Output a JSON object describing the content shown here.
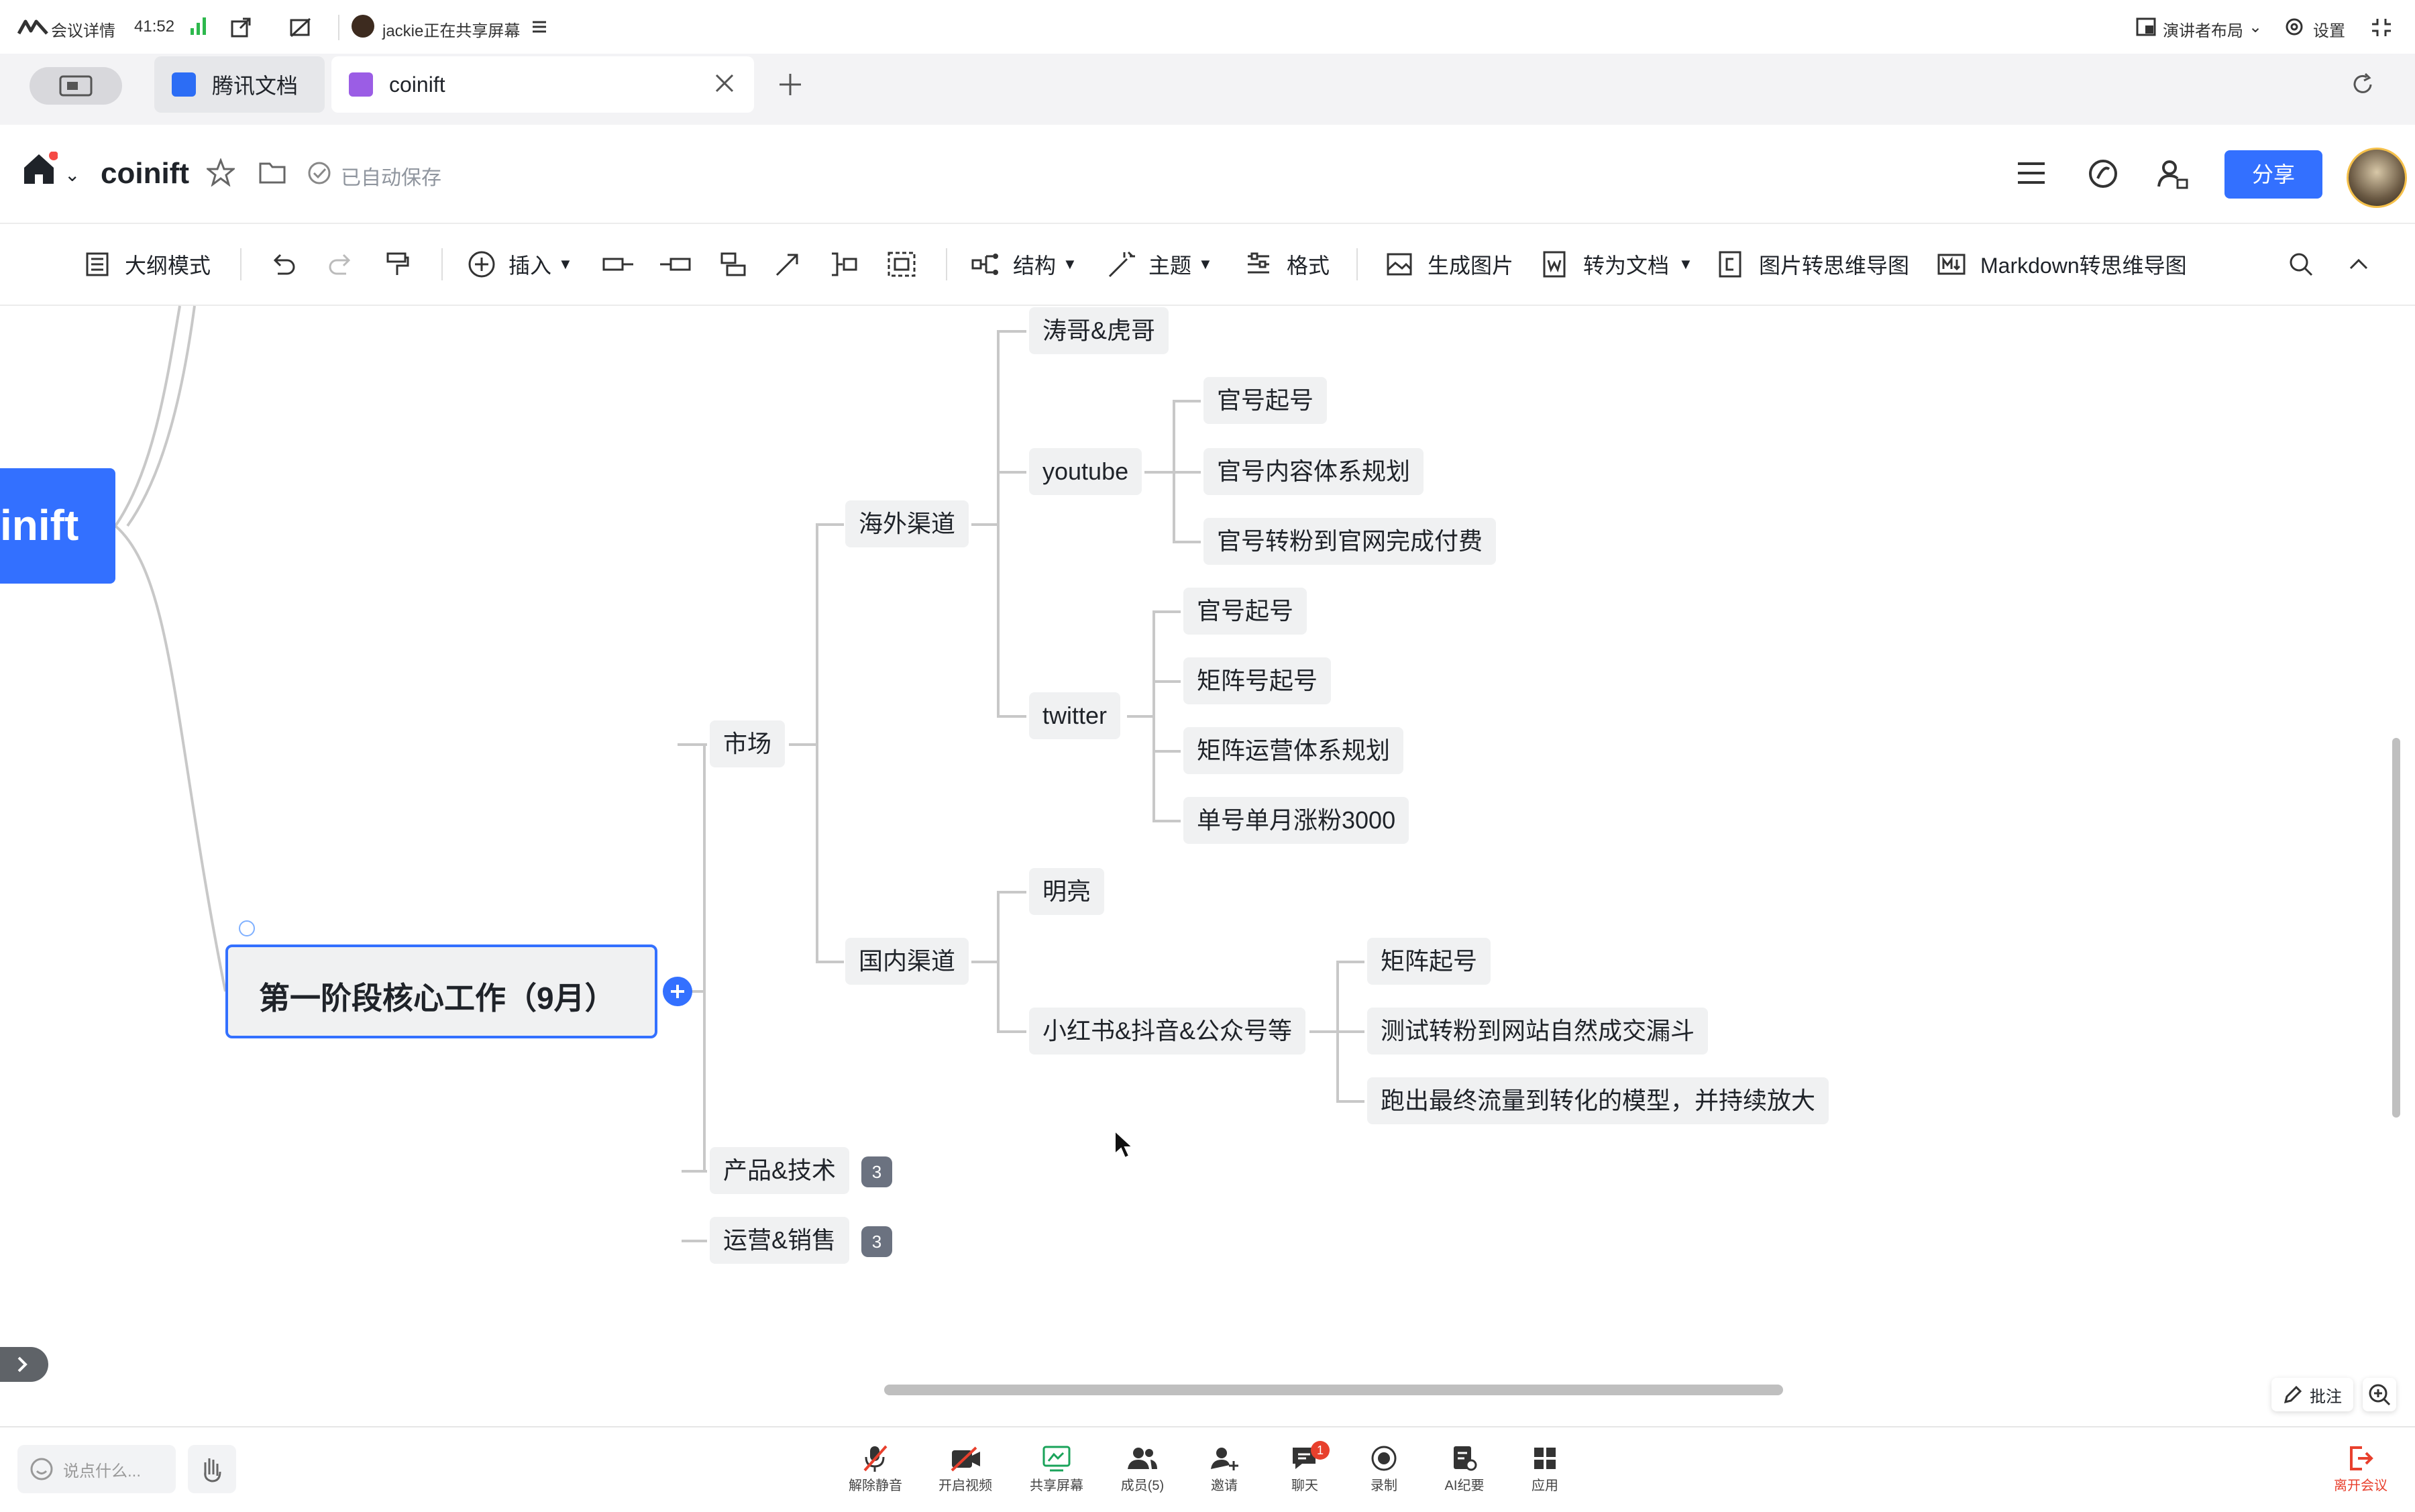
{
  "meeting_bar": {
    "details_label": "会议详情",
    "timer": "41:52",
    "sharing_text": "jackie正在共享屏幕",
    "layout_label": "演讲者布局",
    "settings_label": "设置"
  },
  "tabs": [
    {
      "label": "腾讯文档"
    },
    {
      "label": "coinift"
    }
  ],
  "doc": {
    "title": "coinift",
    "save_status": "已自动保存",
    "share_label": "分享"
  },
  "toolbar": {
    "outline": "大纲模式",
    "insert": "插入",
    "structure": "结构",
    "theme": "主题",
    "format": "格式",
    "gen_image": "生成图片",
    "to_doc": "转为文档",
    "img_to_mindmap": "图片转思维导图",
    "md_to_mindmap": "Markdown转思维导图"
  },
  "mindmap": {
    "root_fragment": "inift",
    "stage": "第一阶段核心工作（9月）",
    "market": "市场",
    "overseas": "海外渠道",
    "tao_hu": "涛哥&虎哥",
    "youtube": "youtube",
    "yt_items": [
      "官号起号",
      "官号内容体系规划",
      "官号转粉到官网完成付费"
    ],
    "twitter": "twitter",
    "tw_items": [
      "官号起号",
      "矩阵号起号",
      "矩阵运营体系规划",
      "单号单月涨粉3000"
    ],
    "domestic": "国内渠道",
    "mingliang": "明亮",
    "xhs": "小红书&抖音&公众号等",
    "xhs_items": [
      "矩阵起号",
      "测试转粉到网站自然成交漏斗",
      "跑出最终流量到转化的模型，并持续放大"
    ],
    "product_tech": "产品&技术",
    "product_tech_count": "3",
    "ops_sales": "运营&销售",
    "ops_sales_count": "3"
  },
  "canvas_controls": {
    "annotate": "批注"
  },
  "bottom_bar": {
    "chat_placeholder": "说点什么...",
    "buttons": [
      "解除静音",
      "开启视频",
      "共享屏幕",
      "成员(5)",
      "邀请",
      "聊天",
      "录制",
      "AI纪要",
      "应用"
    ],
    "chat_badge": "1",
    "leave": "离开会议"
  },
  "colors": {
    "accent": "#3370ff",
    "node_bg": "#f0f1f2",
    "connector": "#c8c8c8",
    "leave": "#e8402d"
  }
}
